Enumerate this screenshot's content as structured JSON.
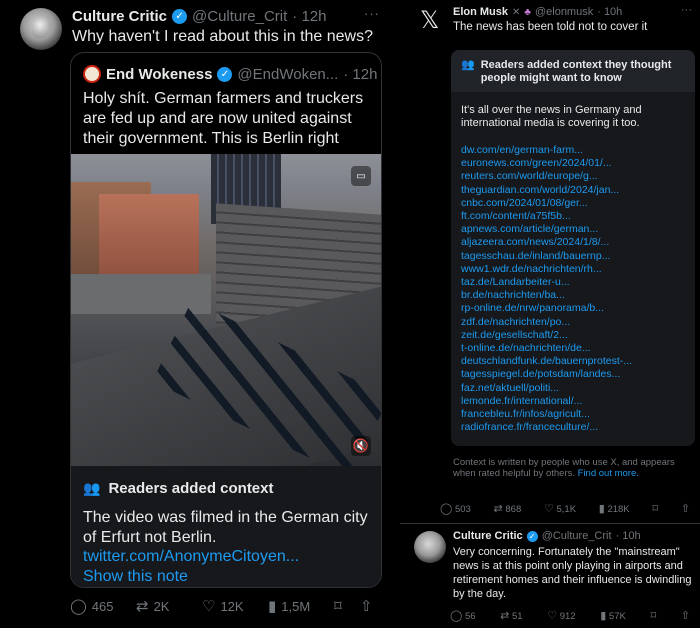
{
  "left_tweet": {
    "author": "Culture Critic",
    "handle": "@Culture_Crit",
    "time": "· 12h",
    "more": "···",
    "text": "Why haven't I read about this in the news?",
    "quoted": {
      "author": "End Wokeness",
      "handle": "@EndWoken...",
      "time": "· 12h",
      "text": "Holy shít. German farmers and truckers are fed up and are now united against their government. This is Berlin right now:",
      "context": {
        "title": "Readers added context",
        "body": "The video was filmed in the German city of Erfurt not Berlin.",
        "link": "twitter.com/AnonymeCitoyen...",
        "show_note": "Show this note"
      }
    },
    "actions": {
      "replies": "465",
      "reposts": "2K",
      "likes": "12K",
      "views": "1,5M"
    }
  },
  "right_tweet": {
    "author": "Elon Musk",
    "handle": "@elonmusk",
    "time": "· 10h",
    "more": "···",
    "text": "The news has been told not to cover it",
    "note": {
      "title": "Readers added context they thought people might want to know",
      "body": "It's all over the news in Germany and international media is covering it too.",
      "links": [
        "dw.com/en/german-farm...",
        "euronews.com/green/2024/01/...",
        "reuters.com/world/europe/g...",
        "theguardian.com/world/2024/jan...",
        "cnbc.com/2024/01/08/ger...",
        "ft.com/content/a75f5b...",
        "apnews.com/article/german...",
        "aljazeera.com/news/2024/1/8/...",
        "tagesschau.de/inland/bauernp...",
        "www1.wdr.de/nachrichten/rh...",
        "taz.de/Landarbeiter-u...",
        "br.de/nachrichten/ba...",
        "rp-online.de/nrw/panorama/b...",
        "zdf.de/nachrichten/po...",
        "zeit.de/gesellschaft/2...",
        "t-online.de/nachrichten/de...",
        "deutschlandfunk.de/bauernprotest-...",
        "tagesspiegel.de/potsdam/landes...",
        "faz.net/aktuell/politi...",
        "lemonde.fr/international/...",
        "francebleu.fr/infos/agricult...",
        "radiofrance.fr/franceculture/..."
      ]
    },
    "context_info": "Context is written by people who use X, and appears when rated helpful by others.",
    "find_out_more": "Find out more.",
    "actions": {
      "replies": "503",
      "reposts": "868",
      "likes": "5,1K",
      "views": "218K"
    }
  },
  "reply_tweet": {
    "author": "Culture Critic",
    "handle": "@Culture_Crit",
    "time": "· 10h",
    "text": "Very concerning. Fortunately the \"mainstream\" news is at this point only playing in airports and retirement homes and their influence is dwindling by the day.",
    "actions": {
      "replies": "56",
      "reposts": "51",
      "likes": "912",
      "views": "57K"
    }
  },
  "colors": {
    "background": "#000000",
    "accent": "#1d9bf0",
    "text": "#e7e9ea",
    "muted": "#71767b",
    "card": "#16181c"
  }
}
